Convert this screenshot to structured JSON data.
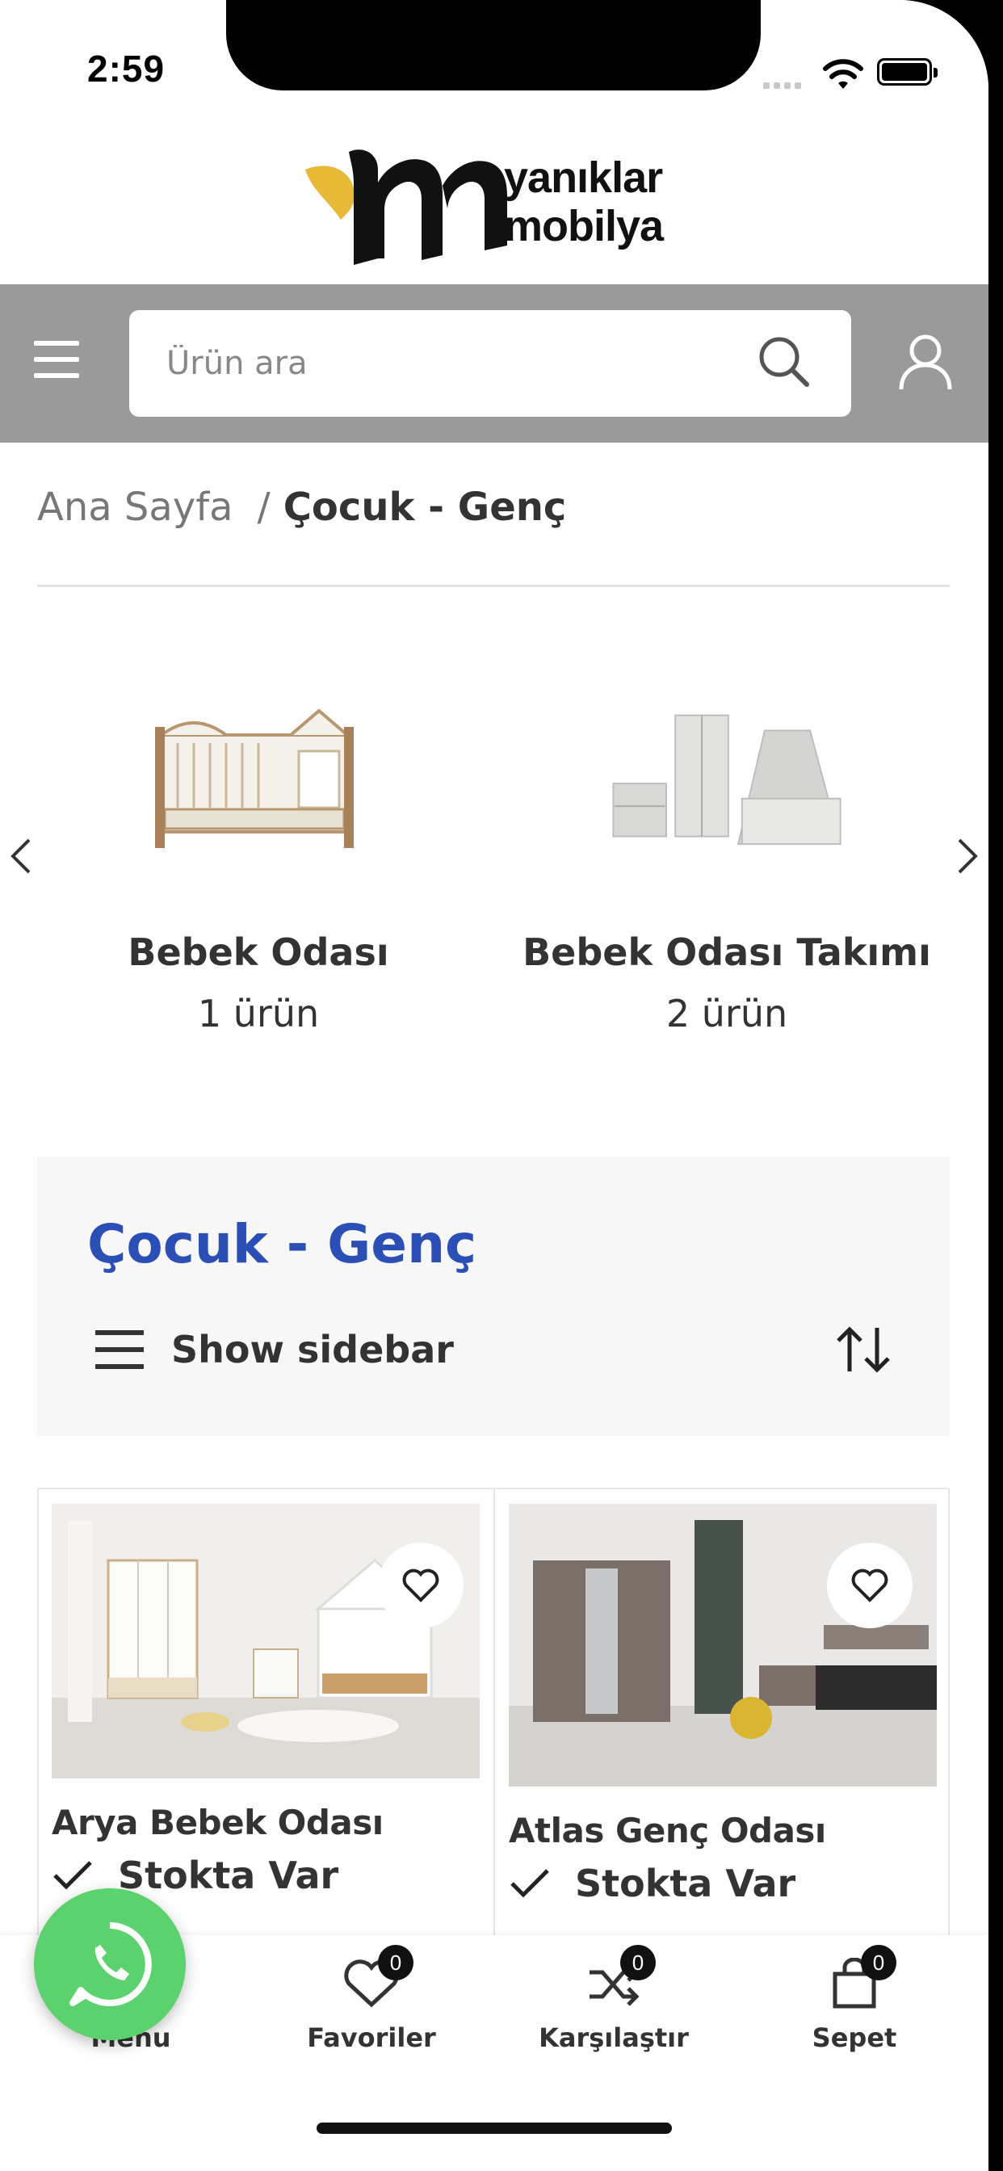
{
  "status_bar": {
    "time": "2:59"
  },
  "brand": {
    "line1": "yanıklar",
    "line2": "mobilya",
    "accent_color": "#e8b937"
  },
  "search": {
    "placeholder": "Ürün ara"
  },
  "breadcrumb": {
    "home": "Ana Sayfa",
    "separator": "/",
    "current": "Çocuk - Genç"
  },
  "categories": [
    {
      "name": "Bebek Odası",
      "count": "1 ürün",
      "icon": "crib-image"
    },
    {
      "name": "Bebek Odası Takımı",
      "count": "2 ürün",
      "icon": "nursery-set-image"
    }
  ],
  "page_heading": {
    "title": "Çocuk - Genç",
    "title_color": "#2b4fb4",
    "sidebar_label": "Show sidebar"
  },
  "products": [
    {
      "name": "Arya Bebek Odası",
      "stock": "Stokta Var"
    },
    {
      "name": "Atlas Genç Odası",
      "stock": "Stokta Var"
    }
  ],
  "bottom_nav": {
    "menu": "Menu",
    "favorites": "Favoriler",
    "favorites_count": "0",
    "compare": "Karşılaştır",
    "compare_count": "0",
    "cart": "Sepet",
    "cart_count": "0"
  },
  "whatsapp_color": "#5bd26d"
}
